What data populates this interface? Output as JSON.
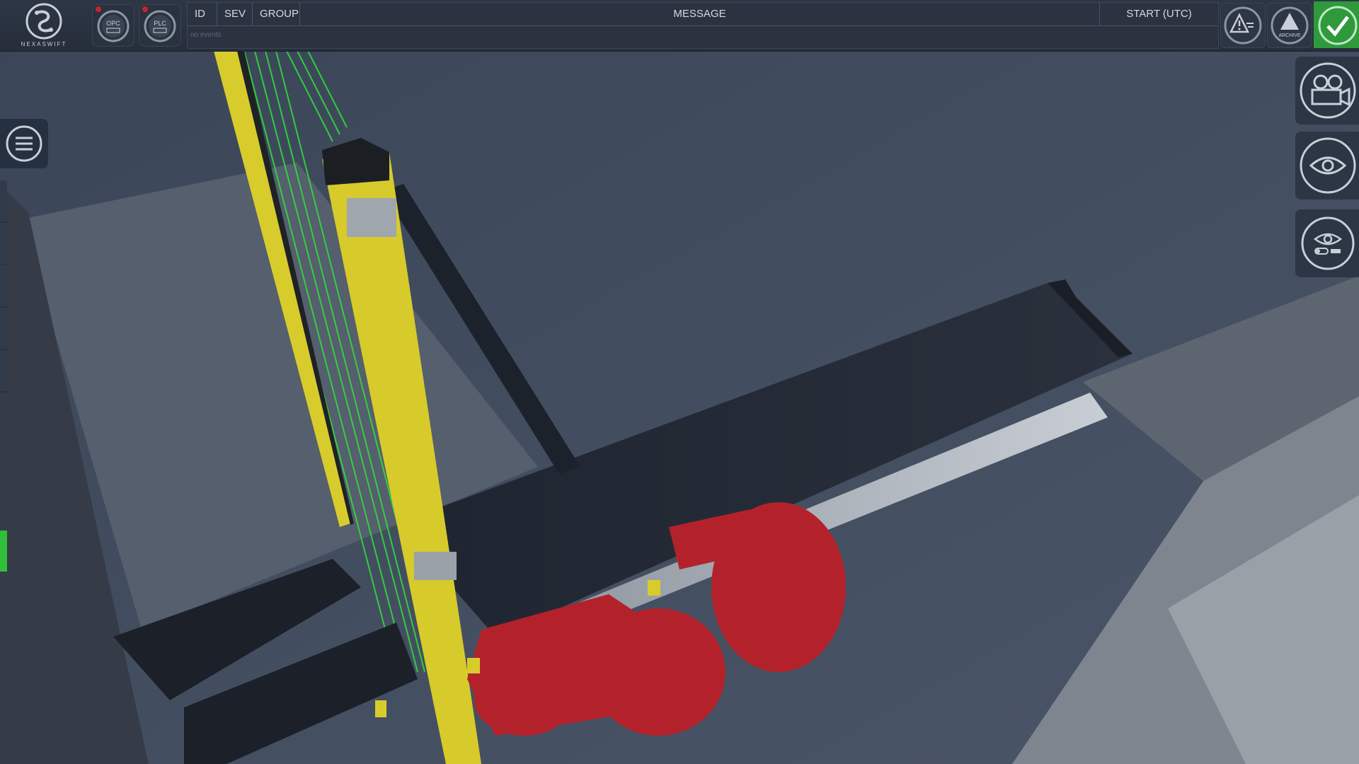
{
  "app": {
    "brand": "NEXASWIFT"
  },
  "connections": [
    {
      "label": "OPC",
      "status_color": "#c8232c"
    },
    {
      "label": "PLC",
      "status_color": "#c8232c"
    }
  ],
  "alarms": {
    "columns": [
      "ID",
      "SEV",
      "GROUP",
      "MESSAGE",
      "START (UTC)"
    ],
    "empty_text": "no events",
    "rows": []
  },
  "toolbar": {
    "alarm_icon": "warning-list-icon",
    "archive_label": "ARCHIVE",
    "ack_icon": "checkmark-icon",
    "ack_color": "#2f9a3c"
  },
  "left_panel": {
    "menu_icon": "hamburger-menu-icon",
    "status_color": "#2fbf3a"
  },
  "right_tools": [
    {
      "icon": "camera-icon"
    },
    {
      "icon": "eye-icon"
    },
    {
      "icon": "eye-toggle-icon"
    }
  ],
  "scene": {
    "background": "#3e4a5c",
    "light_curtain_color": "#d8cc2c",
    "beam_color": "#2ee33a",
    "robot_color": "#b3222b"
  }
}
